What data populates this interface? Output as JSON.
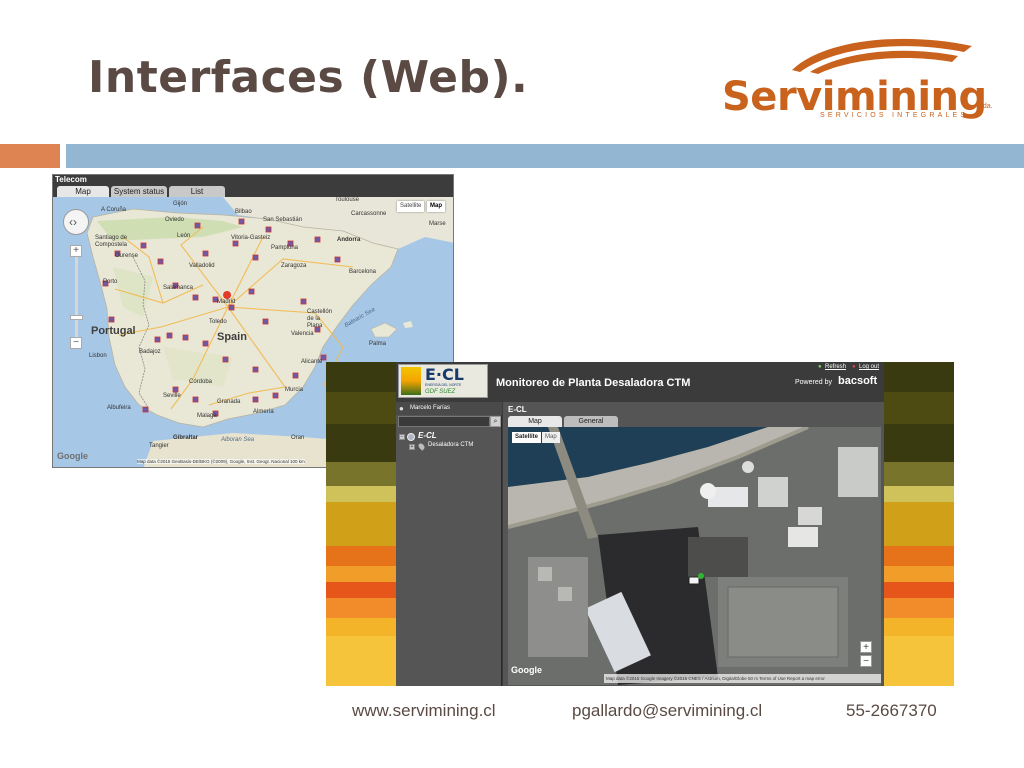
{
  "slide": {
    "title": "Interfaces (Web).",
    "logo": {
      "word": "Servimining",
      "tagline": "SERVICIOS INTEGRALES",
      "suffix": "Ltda.",
      "color": "#c9621c"
    },
    "accent_orange": "#dd8452",
    "accent_blue": "#93b6d2"
  },
  "map_app": {
    "app_name": "Telecom",
    "tabs": [
      {
        "label": "Map",
        "active": true
      },
      {
        "label": "System status",
        "active": false
      },
      {
        "label": "List",
        "active": false
      }
    ],
    "map_type": {
      "satellite": "Satellite",
      "map": "Map"
    },
    "zoom_in": "+",
    "zoom_out": "−",
    "google_label": "Google",
    "attribution": "Map data ©2015 GeoBasis-DE/BKG (©2009), Google, Inst. Geogr. Nacional    100 km",
    "labels": {
      "country_spain": "Spain",
      "country_portugal": "Portugal",
      "andorra": "Andorra",
      "gibraltar": "Gibraltar",
      "a_coruna": "A Coruña",
      "gijon": "Gijón",
      "oviedo": "Oviedo",
      "bilbao": "Bilbao",
      "san_sebastian": "San Sebastián",
      "toulouse": "Toulouse",
      "carcassonne": "Carcassonne",
      "marseille": "Marse",
      "santiago": "Santiago de Compostela",
      "leon": "León",
      "vitoria": "Vitoria-Gasteiz",
      "pamplona": "Pamplona",
      "ourense": "Ourense",
      "valladolid": "Valladolid",
      "zaragoza": "Zaragoza",
      "barcelona": "Barcelona",
      "porto": "Porto",
      "salamanca": "Salamanca",
      "madrid": "Madrid",
      "castellon": "Castellón de la Plana",
      "palma": "Palma",
      "balearic": "Balearic Sea",
      "toledo": "Toledo",
      "valencia": "Valencia",
      "lisbon": "Lisbon",
      "badajoz": "Badajoz",
      "alicante": "Alicante",
      "cordoba": "Córdoba",
      "murcia": "Murcia",
      "seville": "Seville",
      "granada": "Granada",
      "albufeira": "Albufeira",
      "malaga": "Malaga",
      "almeria": "Almería",
      "tangier": "Tangier",
      "oran": "Oran",
      "alboran": "Alboran Sea"
    }
  },
  "plant_app": {
    "logo": {
      "word": "E·CL",
      "line1": "ENERGÍA DEL NORTE",
      "line2": "GDF SUEZ"
    },
    "title": "Monitoreo de Planta Desaladora CTM",
    "refresh": "Refresh",
    "logout": "Log out",
    "powered_by": "Powered by",
    "brand": "bacsoft",
    "user": "Marcelo Farías",
    "tree": {
      "root": "E-CL",
      "child": "Desaladora CTM"
    },
    "breadcrumb": "E-CL",
    "tabs": [
      {
        "label": "Map",
        "active": true
      },
      {
        "label": "General",
        "active": false
      }
    ],
    "map_type": {
      "satellite": "Satellite",
      "map": "Map"
    },
    "zoom_in": "+",
    "zoom_out": "−",
    "google_label": "Google",
    "attribution": "Map data ©2015 Google Imagery ©2015 CNES / Astrium, DigitalGlobe   50 m     Terms of Use   Report a map error"
  },
  "footer": {
    "website": "www.servimining.cl",
    "email": "pgallardo@servimining.cl",
    "phone": "55-2667370"
  }
}
